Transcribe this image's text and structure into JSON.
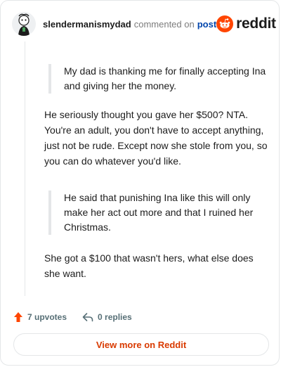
{
  "header": {
    "username": "slendermanismydad",
    "commented": "commented on",
    "post_link": "post",
    "brand": "reddit"
  },
  "comment": {
    "quote1": "My dad is thanking me for finally accepting Ina and giving her the money.",
    "para1": "He seriously thought you gave her $500? NTA. You're an adult, you don't have to accept anything, just not be rude. Except now she stole from you, so you can do whatever you'd like.",
    "quote2": "He said that punishing Ina like this will only make her act out more and that I ruined her Christmas.",
    "para2": "She got a $100 that wasn't hers, what else does she want."
  },
  "footer": {
    "upvotes": "7 upvotes",
    "replies": "0 replies",
    "upvote_icon": "upvote-arrow-icon",
    "reply_icon": "reply-arrow-icon"
  },
  "actions": {
    "view_more": "View more on Reddit"
  },
  "colors": {
    "brand": "#ff4500",
    "link": "#0045ac",
    "view_more": "#d93a00"
  }
}
